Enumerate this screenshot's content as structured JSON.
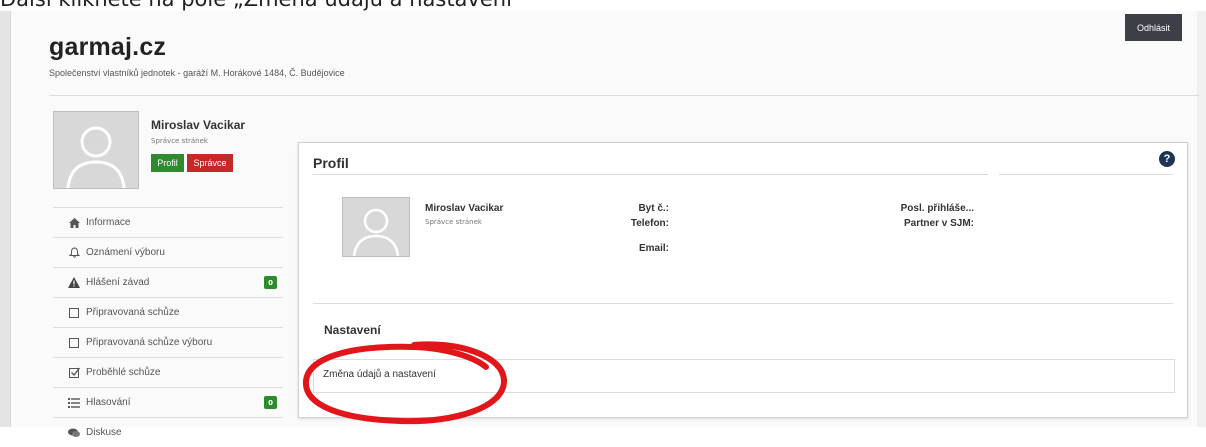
{
  "caption": "Další kliknete na pole „Změna údajů a nastavení“",
  "header": {
    "site_title": "garmaj.cz",
    "site_subtitle": "Společenství vlastníků jednotek - garáží M. Horákové 1484, Č. Budějovice",
    "logout_label": "Odhlásit"
  },
  "sidebar": {
    "user": {
      "name": "Miroslav Vacikar",
      "role": "Správce stránek",
      "badge_profil": "Profil",
      "badge_spravce": "Správce"
    },
    "items": [
      {
        "label": "Informace",
        "icon": "home-icon",
        "badge": null
      },
      {
        "label": "Oznámení výboru",
        "icon": "bell-icon",
        "badge": null
      },
      {
        "label": "Hlášení závad",
        "icon": "warning-icon",
        "badge": "0"
      },
      {
        "label": "Připravovaná schůze",
        "icon": "checkbox-empty-icon",
        "badge": null
      },
      {
        "label": "Připravovaná schůze výboru",
        "icon": "checkbox-empty-icon",
        "badge": null
      },
      {
        "label": "Proběhlé schůze",
        "icon": "checkbox-checked-icon",
        "badge": null
      },
      {
        "label": "Hlasování",
        "icon": "list-icon",
        "badge": "0"
      },
      {
        "label": "Diskuse",
        "icon": "comments-icon",
        "badge": null
      }
    ]
  },
  "profile": {
    "title": "Profil",
    "name": "Miroslav Vacikar",
    "role": "Správce stránek",
    "fields": {
      "byt": "Byt č.:",
      "telefon": "Telefon:",
      "email": "Email:",
      "posl": "Posl. přihláše...",
      "partner": "Partner v SJM:"
    }
  },
  "settings": {
    "title": "Nastavení",
    "link_label": "Změna údajů a nastavení"
  },
  "colors": {
    "green": "#2e8b2e",
    "red": "#c62828",
    "annotation": "#e0161b",
    "dark_button": "#3c4046"
  }
}
